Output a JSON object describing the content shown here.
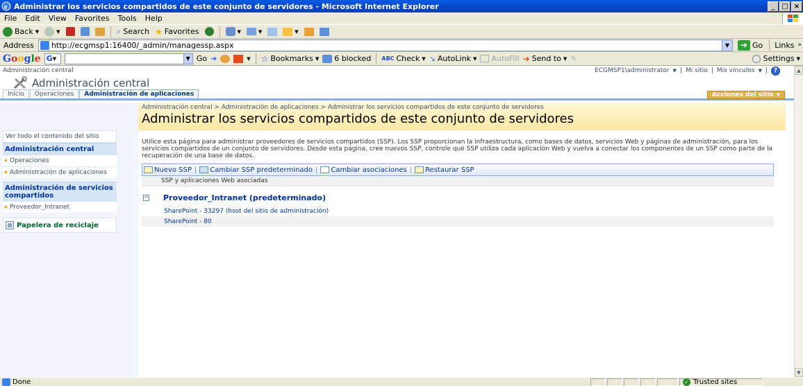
{
  "window": {
    "title": "Administrar los servicios compartidos de este conjunto de servidores - Microsoft Internet Explorer",
    "buttons": {
      "minimize": "_",
      "maximize": "□",
      "close": "×"
    }
  },
  "menu": {
    "items": [
      {
        "label": "File"
      },
      {
        "label": "Edit"
      },
      {
        "label": "View"
      },
      {
        "label": "Favorites"
      },
      {
        "label": "Tools"
      },
      {
        "label": "Help"
      }
    ]
  },
  "toolbar": {
    "back_label": "Back",
    "search_label": "Search",
    "favorites_label": "Favorites"
  },
  "address": {
    "label": "Address",
    "url": "http://ecgmsp1:16400/_admin/managessp.aspx",
    "go_label": "Go",
    "links_label": "Links"
  },
  "googlebar": {
    "logo": [
      "G",
      "o",
      "o",
      "g",
      "l",
      "e"
    ],
    "go_label": "Go",
    "bookmarks_label": "Bookmarks",
    "blocked_label": "6 blocked",
    "check_label": "Check",
    "autolink_label": "AutoLink",
    "autofill_label": "AutoFill",
    "sendto_label": "Send to",
    "settings_label": "Settings"
  },
  "sharepoint": {
    "site_link": "Administración central",
    "user": "ECGMSP1\\administrator",
    "my_site": "Mi sitio",
    "my_links": "Mis vínculos",
    "site_title": "Administración central",
    "tabs": [
      {
        "label": "Inicio"
      },
      {
        "label": "Operaciones"
      },
      {
        "label": "Administración de aplicaciones"
      }
    ],
    "site_actions": "Acciones del sitio",
    "breadcrumb": "Administración central > Administración de aplicaciones > Administrar los servicios compartidos de este conjunto de servidores",
    "page_title": "Administrar los servicios compartidos de este conjunto de servidores",
    "leftnav": {
      "view_all": "Ver todo el contenido del sitio",
      "section1": "Administración central",
      "item1": "Operaciones",
      "item2": "Administración de aplicaciones",
      "section2": "Administración de servicios compartidos",
      "item3": "Proveedor_Intranet",
      "recycle": "Papelera de reciclaje"
    },
    "description": "Utilice esta página para administrar proveedores de servicios compartidos (SSP). Los SSP proporcionan la infraestructura, como bases de datos, servicios Web y páginas de administración, para los servicios compartidos de un conjunto de servidores. Desde esta página, cree nuevos SSP, controle qué SSP utiliza cada aplicación Web y vuelva a conectar los componentes de un SSP como parte de la recuperación de una base de datos.",
    "actions": {
      "new_ssp": "Nuevo SSP",
      "change_default": "Cambiar SSP predeterminado",
      "change_assoc": "Cambiar asociaciones",
      "restore": "Restaurar SSP"
    },
    "list_header": "SSP y aplicaciones Web asociadas",
    "group_title": "Proveedor_Intranet (predeterminado)",
    "apps": [
      {
        "label": "SharePoint - 33297 (host del sitio de administración)"
      },
      {
        "label": "SharePoint - 80"
      }
    ]
  },
  "status": {
    "done": "Done",
    "zone": "Trusted sites"
  }
}
